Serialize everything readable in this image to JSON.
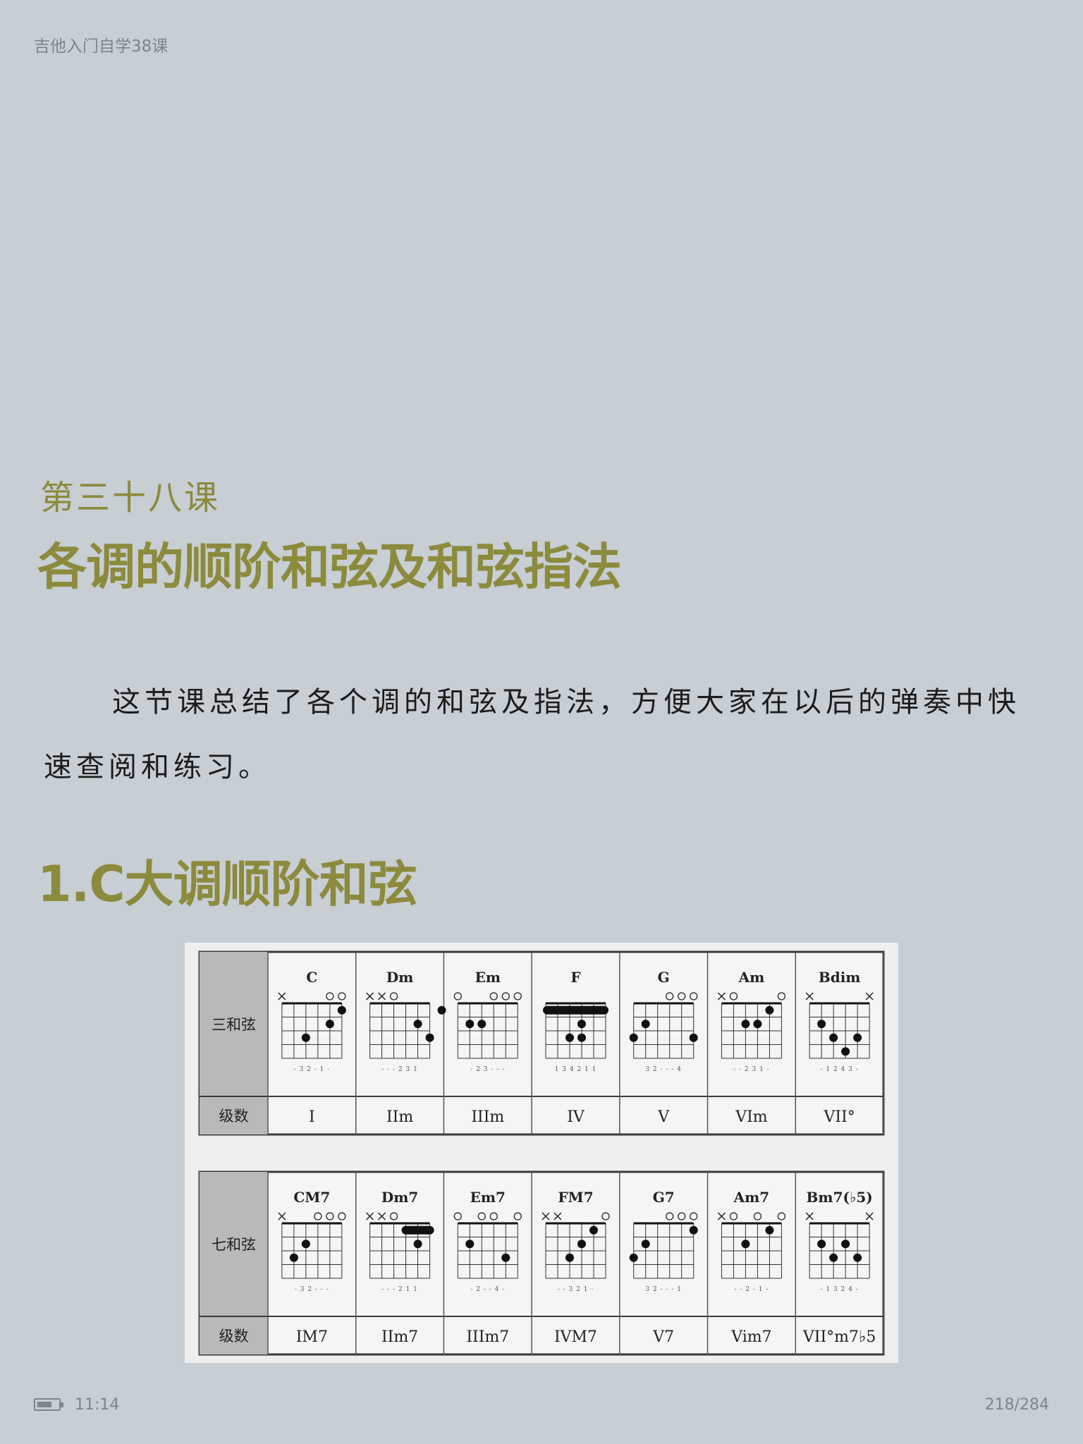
{
  "header": {
    "book_title": "吉他入门自学38课"
  },
  "lesson": {
    "number": "第三十八课",
    "title": "各调的顺阶和弦及和弦指法",
    "intro": "这节课总结了各个调的和弦及指法，方便大家在以后的弹奏中快速查阅和练习。"
  },
  "section": {
    "title": "1.C大调顺阶和弦"
  },
  "chord_tables": [
    {
      "row_label": "三和弦",
      "degree_label": "级数",
      "chords": [
        {
          "name": "C",
          "marks": [
            "x",
            "",
            "",
            "",
            "o",
            "o"
          ],
          "fingering": "- 3 2 - 1 -",
          "dots": [
            [
              5,
              1
            ],
            [
              4,
              2
            ],
            [
              2,
              3
            ]
          ],
          "degree": "I"
        },
        {
          "name": "Dm",
          "marks": [
            "x",
            "x",
            "o",
            "",
            "",
            ""
          ],
          "fingering": "- - - 2 3 1",
          "dots": [
            [
              6,
              1
            ],
            [
              4,
              2
            ],
            [
              5,
              3
            ]
          ],
          "degree": "IIm"
        },
        {
          "name": "Em",
          "marks": [
            "o",
            "",
            "",
            "o",
            "o",
            "o"
          ],
          "fingering": "- 2 3 - - -",
          "dots": [
            [
              1,
              2
            ],
            [
              2,
              2
            ]
          ],
          "degree": "IIIm"
        },
        {
          "name": "F",
          "marks": [
            "",
            "",
            "",
            "",
            "",
            ""
          ],
          "fingering": "1 3 4 2 1 1",
          "dots": [
            [
              3,
              2
            ],
            [
              2,
              3
            ],
            [
              3,
              3
            ]
          ],
          "barre": 1,
          "degree": "IV"
        },
        {
          "name": "G",
          "marks": [
            "",
            "",
            "",
            "o",
            "o",
            "o"
          ],
          "fingering": "3 2 - - - 4",
          "dots": [
            [
              1,
              2
            ],
            [
              0,
              3
            ],
            [
              5,
              3
            ]
          ],
          "degree": "V"
        },
        {
          "name": "Am",
          "marks": [
            "x",
            "o",
            "",
            "",
            "",
            "o"
          ],
          "fingering": "- - 2 3 1 -",
          "dots": [
            [
              4,
              1
            ],
            [
              2,
              2
            ],
            [
              3,
              2
            ]
          ],
          "degree": "VIm"
        },
        {
          "name": "Bdim",
          "marks": [
            "x",
            "",
            "",
            "",
            "",
            "x"
          ],
          "fingering": "- 1 2 4 3 -",
          "dots": [
            [
              1,
              2
            ],
            [
              2,
              3
            ],
            [
              4,
              3
            ],
            [
              3,
              4
            ]
          ],
          "degree": "VII°"
        }
      ]
    },
    {
      "row_label": "七和弦",
      "degree_label": "级数",
      "chords": [
        {
          "name": "CM7",
          "marks": [
            "x",
            "",
            "",
            "o",
            "o",
            "o"
          ],
          "fingering": "- 3 2 - - -",
          "dots": [
            [
              2,
              2
            ],
            [
              1,
              3
            ]
          ],
          "degree": "IM7"
        },
        {
          "name": "Dm7",
          "marks": [
            "x",
            "x",
            "o",
            "",
            "",
            ""
          ],
          "fingering": "- - - 2 1 1",
          "dots": [
            [
              4,
              2
            ]
          ],
          "barre_top": 1,
          "degree": "IIm7"
        },
        {
          "name": "Em7",
          "marks": [
            "o",
            "",
            "o",
            "o",
            "",
            "o"
          ],
          "fingering": "- 2 - - 4 -",
          "dots": [
            [
              1,
              2
            ],
            [
              4,
              3
            ]
          ],
          "degree": "IIIm7"
        },
        {
          "name": "FM7",
          "marks": [
            "x",
            "x",
            "",
            "",
            "",
            "o"
          ],
          "fingering": "- - 3 2 1 -",
          "dots": [
            [
              4,
              1
            ],
            [
              3,
              2
            ],
            [
              2,
              3
            ]
          ],
          "degree": "IVM7"
        },
        {
          "name": "G7",
          "marks": [
            "",
            "",
            "",
            "o",
            "o",
            "o"
          ],
          "fingering": "3 2 - - - 1",
          "dots": [
            [
              5,
              1
            ],
            [
              1,
              2
            ],
            [
              0,
              3
            ]
          ],
          "degree": "V7"
        },
        {
          "name": "Am7",
          "marks": [
            "x",
            "o",
            "",
            "o",
            "",
            "o"
          ],
          "fingering": "- - 2 - 1 -",
          "dots": [
            [
              4,
              1
            ],
            [
              2,
              2
            ]
          ],
          "degree": "Vim7"
        },
        {
          "name": "Bm7(♭5)",
          "marks": [
            "x",
            "",
            "",
            "",
            "",
            "x"
          ],
          "fingering": "- 1 3 2 4 -",
          "dots": [
            [
              1,
              2
            ],
            [
              3,
              2
            ],
            [
              2,
              3
            ],
            [
              4,
              3
            ]
          ],
          "degree": "VII°m7♭5"
        }
      ]
    }
  ],
  "status": {
    "clock": "11:14",
    "page": "218/284",
    "battery_level": 0.7
  }
}
